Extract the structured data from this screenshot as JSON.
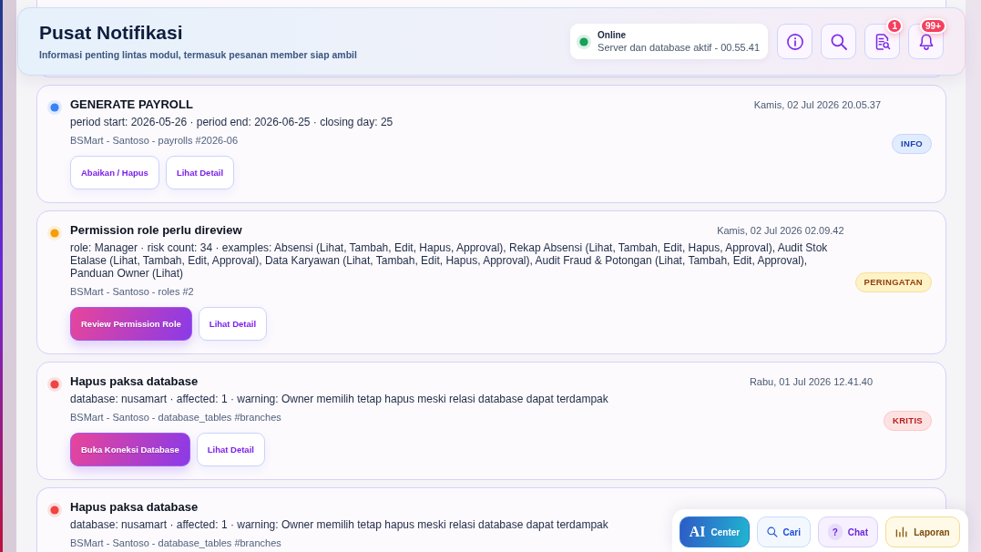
{
  "header": {
    "title": "Pusat Notifikasi",
    "subtitle": "Informasi penting lintas modul, termasuk pesanan member siap ambil",
    "status": {
      "online": true,
      "label": "Online",
      "detail": "Server dan database aktif - 00.55.41"
    },
    "icon_buttons": [
      {
        "kind": "info"
      },
      {
        "kind": "search"
      },
      {
        "kind": "report",
        "badge": "1"
      },
      {
        "kind": "notifications",
        "badge": "99+"
      }
    ]
  },
  "notifications": [
    {
      "title": "GENERATE PAYROLL",
      "color": "#3b82f6",
      "time": "Kamis, 02 Jul 2026 20.05.37",
      "body": "period start: 2026-05-26 · period end: 2026-06-25 · closing day: 25",
      "meta": "BSMart - Santoso - payrolls #2026-06",
      "actions": [
        {
          "kind": "secondary",
          "label": "Abaikan / Hapus"
        },
        {
          "kind": "secondary",
          "label": "Lihat Detail"
        }
      ],
      "badge": {
        "kind": "info",
        "label": "INFO"
      }
    },
    {
      "title": "Permission role perlu direview",
      "color": "#f59e0b",
      "time": "Kamis, 02 Jul 2026 02.09.42",
      "body": "role: Manager · risk count: 34 · examples: Absensi (Lihat, Tambah, Edit, Hapus, Approval), Rekap Absensi (Lihat, Tambah, Edit, Hapus, Approval), Audit Stok Etalase (Lihat, Tambah, Edit, Approval), Data Karyawan (Lihat, Tambah, Edit, Hapus, Approval), Audit Fraud & Potongan (Lihat, Tambah, Edit, Approval), Panduan Owner (Lihat)",
      "meta": "BSMart - Santoso - roles #2",
      "actions": [
        {
          "kind": "primary",
          "label": "Review Permission Role"
        },
        {
          "kind": "secondary",
          "label": "Lihat Detail"
        }
      ],
      "badge": {
        "kind": "warning",
        "label": "PERINGATAN"
      }
    },
    {
      "title": "Hapus paksa database",
      "color": "#ef4444",
      "time": "Rabu, 01 Jul 2026 12.41.40",
      "body": "database: nusamart · affected: 1 · warning: Owner memilih tetap hapus meski relasi database dapat terdampak",
      "meta": "BSMart - Santoso - database_tables #branches",
      "actions": [
        {
          "kind": "primary",
          "label": "Buka Koneksi Database"
        },
        {
          "kind": "secondary",
          "label": "Lihat Detail"
        }
      ],
      "badge": {
        "kind": "critical",
        "label": "KRITIS"
      }
    },
    {
      "title": "Hapus paksa database",
      "color": "#ef4444",
      "body": "database: nusamart · affected: 1 · warning: Owner memilih tetap hapus meski relasi database dapat terdampak",
      "meta": "BSMart - Santoso - database_tables #branches"
    }
  ],
  "dock": [
    {
      "kind": "ai",
      "mark": "AI",
      "label": "Center"
    },
    {
      "kind": "search",
      "label": "Cari"
    },
    {
      "kind": "chat",
      "icon_text": "?",
      "label": "Chat"
    },
    {
      "kind": "reports",
      "label": "Laporan"
    }
  ]
}
